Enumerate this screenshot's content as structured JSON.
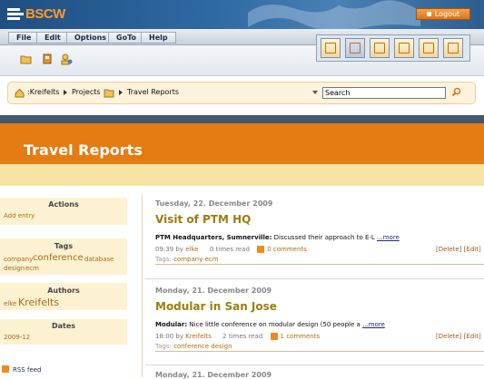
{
  "app": {
    "logo": "BSCW",
    "logout_label": "Logout"
  },
  "menu": [
    "File",
    "Edit",
    "Options",
    "GoTo",
    "Help"
  ],
  "breadcrumb": [
    ":Kreifelts",
    "Projects",
    "Travel Reports"
  ],
  "search": {
    "value": "Search"
  },
  "banner": {
    "title": "Travel Reports"
  },
  "sidebar": {
    "actions": {
      "heading": "Actions",
      "items": [
        "Add entry"
      ]
    },
    "tags": {
      "heading": "Tags",
      "items": [
        "company",
        "conference",
        "database",
        "design",
        "ecm"
      ]
    },
    "authors": {
      "heading": "Authors",
      "items": [
        "elke",
        "Kreifelts"
      ]
    },
    "dates": {
      "heading": "Dates",
      "items": [
        "2009-12"
      ]
    },
    "rss_label": "RSS feed"
  },
  "entries": [
    {
      "date": "Tuesday, 22. December 2009",
      "title": "Visit of PTM HQ",
      "lead": "PTM Headquarters, Sumnerville:",
      "text": " Discussed their approach to E-L ",
      "more": "...more",
      "time": "09:39 by",
      "author": "elke",
      "reads": "0 times read",
      "comments": "0 comments",
      "delete": "[Delete]",
      "edit": "[Edit]",
      "tags_label": "Tags:",
      "tags": "company ecm"
    },
    {
      "date": "Monday, 21. December 2009",
      "title": "Modular in San Jose",
      "lead": "Modular:",
      "text": " Nice little conference on modular design (50 people a ",
      "more": "...more",
      "time": "18:00 by",
      "author": "Kreifelts",
      "reads": "2 times read",
      "comments": "1 comments",
      "delete": "[Delete]",
      "edit": "[Edit]",
      "tags_label": "Tags:",
      "tags": "conference design"
    }
  ],
  "next_date": "Monday, 21. December 2009",
  "colors": {
    "banner": "#e57b13",
    "header": "#2f6aa3",
    "accent": "#9a7d10"
  }
}
